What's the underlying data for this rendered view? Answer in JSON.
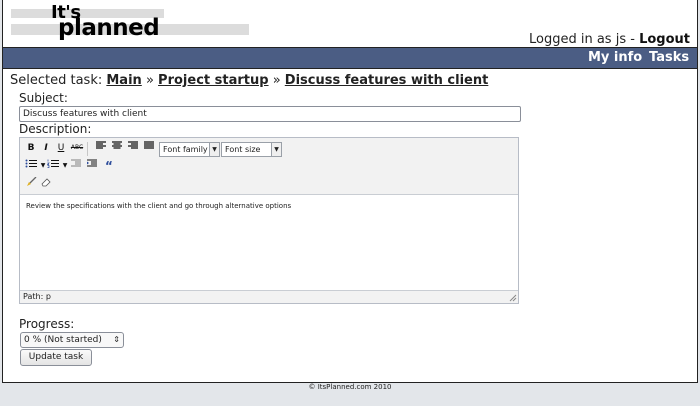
{
  "logo": {
    "line1": "It's",
    "line2": "planned"
  },
  "user": {
    "logged_in_prefix": "Logged in as",
    "username": "js",
    "separator": "-",
    "logout_label": "Logout"
  },
  "nav": {
    "items": [
      "My info",
      "Tasks"
    ]
  },
  "breadcrumb": {
    "prefix": "Selected task:",
    "items": [
      "Main",
      "Project startup",
      "Discuss features with client"
    ],
    "separator": "»"
  },
  "form": {
    "subject_label": "Subject:",
    "subject_value": "Discuss features with client",
    "description_label": "Description:",
    "description_text": "Review the specifications with the client and go through alternative options",
    "editor": {
      "font_family_label": "Font family",
      "font_size_label": "Font size",
      "path_label": "Path: p"
    },
    "progress_label": "Progress:",
    "progress_value": "0 % (Not started)",
    "update_button_label": "Update task"
  },
  "footer": "© ItsPlanned.com 2010",
  "colors": {
    "nav_bg": "#4b5d84",
    "page_bg": "#e3e6ea"
  }
}
